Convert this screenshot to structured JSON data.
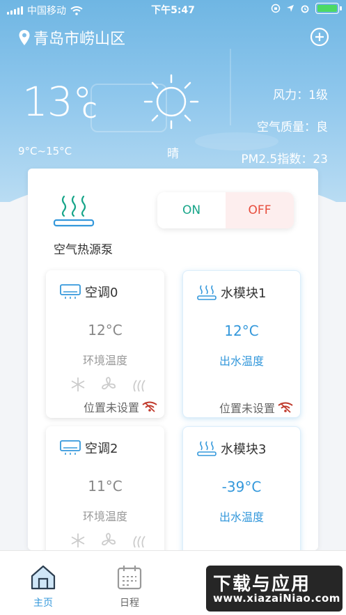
{
  "status_bar": {
    "carrier": "中国移动",
    "time": "下午5:47"
  },
  "header": {
    "location": "青岛市崂山区"
  },
  "weather": {
    "temperature": "13°",
    "unit": "C",
    "range": "9°C~15°C",
    "condition": "晴",
    "wind": "风力：1级",
    "air_quality": "空气质量：良",
    "pm25": "PM2.5指数：23"
  },
  "pump": {
    "label": "空气热源泵",
    "on_label": "ON",
    "off_label": "OFF"
  },
  "devices": [
    {
      "name": "空调0",
      "type": "ac",
      "value": "12°C",
      "caption": "环境温度",
      "location": "位置未设置"
    },
    {
      "name": "水模块1",
      "type": "water",
      "value": "12°C",
      "caption": "出水温度",
      "location": "位置未设置"
    },
    {
      "name": "空调2",
      "type": "ac",
      "value": "11°C",
      "caption": "环境温度",
      "location": ""
    },
    {
      "name": "水模块3",
      "type": "water",
      "value": "-39°C",
      "caption": "出水温度",
      "location": ""
    }
  ],
  "tabs": [
    {
      "label": "主页",
      "active": true
    },
    {
      "label": "日程",
      "active": false
    }
  ],
  "watermark": {
    "title": "下载与应用",
    "url": "www.xiazaiNiao.com"
  },
  "colors": {
    "accent": "#3498db",
    "on": "#17a589",
    "off": "#e74c3c"
  }
}
